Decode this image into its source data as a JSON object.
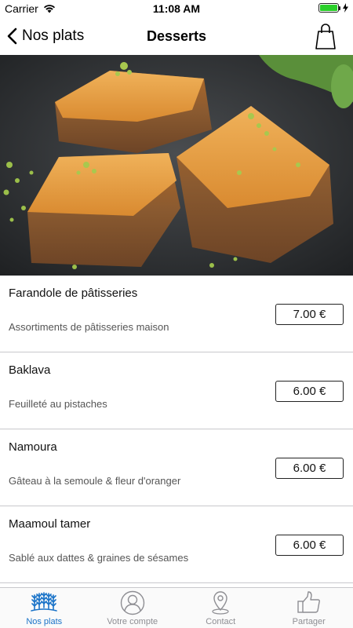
{
  "status_bar": {
    "carrier": "Carrier",
    "time": "11:08 AM",
    "battery_color": "#2bd02b"
  },
  "nav": {
    "back_label": "Nos plats",
    "title": "Desserts"
  },
  "menu_items": [
    {
      "name": "Farandole de pâtisseries",
      "description": "Assortiments de pâtisseries maison",
      "price": "7.00 €"
    },
    {
      "name": "Baklava",
      "description": "Feuilleté au pistaches",
      "price": "6.00 €"
    },
    {
      "name": "Namoura",
      "description": "Gâteau à la semoule & fleur d'oranger",
      "price": "6.00 €"
    },
    {
      "name": "Maamoul tamer",
      "description": "Sablé aux dattes & graines de sésames",
      "price": "6.00 €"
    }
  ],
  "tab_bar": {
    "active_color": "#1a73c8",
    "tabs": [
      {
        "label": "Nos plats",
        "icon": "wheat-icon"
      },
      {
        "label": "Votre compte",
        "icon": "user-icon"
      },
      {
        "label": "Contact",
        "icon": "map-pin-icon"
      },
      {
        "label": "Partager",
        "icon": "thumbs-up-icon"
      }
    ]
  }
}
